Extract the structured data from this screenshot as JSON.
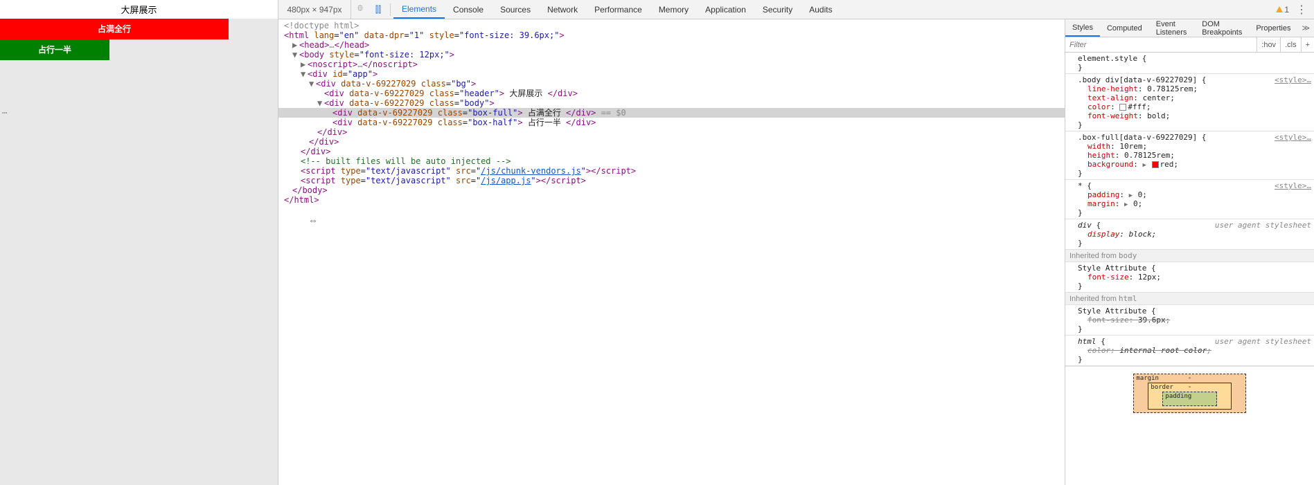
{
  "preview": {
    "header_text": "大屏展示",
    "box_full_text": "占满全行",
    "box_half_text": "占行一半",
    "resize_cursor": "⇔"
  },
  "viewport_label": "480px × 947px",
  "icons": {
    "inspect": "⯐",
    "device": "⫿⫿"
  },
  "tabs": [
    "Elements",
    "Console",
    "Sources",
    "Network",
    "Performance",
    "Memory",
    "Application",
    "Security",
    "Audits"
  ],
  "active_tab": 0,
  "warnings": {
    "count": "1"
  },
  "kebab": "⋮",
  "dom": {
    "doctype": "<!doctype html>",
    "html_open": {
      "tag": "html",
      "attrs": [
        [
          "lang",
          "en"
        ],
        [
          "data-dpr",
          "1"
        ],
        [
          "style",
          "font-size: 39.6px;"
        ]
      ]
    },
    "head": {
      "open": "head",
      "dots": "…",
      "close": "head"
    },
    "body_open": {
      "tag": "body",
      "attrs": [
        [
          "style",
          "font-size: 12px;"
        ]
      ]
    },
    "noscript": {
      "open": "noscript",
      "dots": "…",
      "close": "noscript"
    },
    "app": {
      "tag": "div",
      "attrs": [
        [
          "id",
          "app"
        ]
      ]
    },
    "bg": {
      "tag": "div",
      "attrs": [
        [
          "data-v-69227029",
          ""
        ],
        [
          "class",
          "bg"
        ]
      ]
    },
    "header_div": {
      "tag": "div",
      "attrs": [
        [
          "data-v-69227029",
          ""
        ],
        [
          "class",
          "header"
        ]
      ],
      "text": " 大屏展示 "
    },
    "body_div": {
      "tag": "div",
      "attrs": [
        [
          "data-v-69227029",
          ""
        ],
        [
          "class",
          "body"
        ]
      ]
    },
    "box_full": {
      "tag": "div",
      "attrs": [
        [
          "data-v-69227029",
          ""
        ],
        [
          "class",
          "box-full"
        ]
      ],
      "text": " 占满全行 ",
      "suffix": " == $0"
    },
    "box_half": {
      "tag": "div",
      "attrs": [
        [
          "data-v-69227029",
          ""
        ],
        [
          "class",
          "box-half"
        ]
      ],
      "text": " 占行一半 "
    },
    "close_div": "div",
    "comment": "<!-- built files will be auto injected -->",
    "script1": {
      "tag": "script",
      "attrs": [
        [
          "type",
          "text/javascript"
        ],
        [
          "src",
          "/js/chunk-vendors.js"
        ]
      ]
    },
    "script2": {
      "tag": "script",
      "attrs": [
        [
          "type",
          "text/javascript"
        ],
        [
          "src",
          "/js/app.js"
        ]
      ]
    },
    "close_body": "body",
    "close_html": "html"
  },
  "side_tabs": [
    "Styles",
    "Computed",
    "Event Listeners",
    "DOM Breakpoints",
    "Properties"
  ],
  "active_side_tab": 0,
  "side_more": "≫",
  "filter": {
    "placeholder": "Filter",
    "hov": ":hov",
    "cls": ".cls",
    "plus": "+"
  },
  "rules": {
    "element_style": {
      "selector": "element.style",
      "open": " {",
      "close": "}"
    },
    "body_div": {
      "selector": ".body div[data-v-69227029]",
      "open": " {",
      "src": "<style>…",
      "props": [
        [
          "line-height",
          "0.78125rem"
        ],
        [
          "text-align",
          "center"
        ],
        [
          "color",
          "#fff",
          "white"
        ],
        [
          "font-weight",
          "bold"
        ]
      ],
      "close": "}"
    },
    "box_full": {
      "selector": ".box-full[data-v-69227029]",
      "open": " {",
      "src": "<style>…",
      "props": [
        [
          "width",
          "10rem"
        ],
        [
          "height",
          "0.78125rem"
        ],
        [
          "background",
          "red",
          "red",
          true
        ]
      ],
      "close": "}"
    },
    "star": {
      "selector": "*",
      "open": " {",
      "src": "<style>…",
      "props": [
        [
          "padding",
          "0",
          null,
          true
        ],
        [
          "margin",
          "0",
          null,
          true
        ]
      ],
      "close": "}"
    },
    "div_ua": {
      "selector": "div",
      "open": " {",
      "src": "user agent stylesheet",
      "props": [
        [
          "display",
          "block"
        ]
      ],
      "close": "}",
      "italic": true
    },
    "inh_body_label": "Inherited from ",
    "inh_body_tag": "body",
    "style_attr_body": {
      "selector": "Style Attribute",
      "open": " {",
      "props": [
        [
          "font-size",
          "12px"
        ]
      ],
      "close": "}"
    },
    "inh_html_label": "Inherited from ",
    "inh_html_tag": "html",
    "style_attr_html": {
      "selector": "Style Attribute",
      "open": " {",
      "props": [
        [
          "font-size",
          "39.6px"
        ]
      ],
      "close": "}",
      "struck": true
    },
    "html_ua": {
      "selector": "html",
      "open": " {",
      "src": "user agent stylesheet",
      "props": [
        [
          "color",
          "internal root color"
        ]
      ],
      "close": "}",
      "italic": true,
      "struck": true
    }
  },
  "box_model": {
    "margin": "margin",
    "border": "border",
    "padding": "padding",
    "dash": "-"
  }
}
